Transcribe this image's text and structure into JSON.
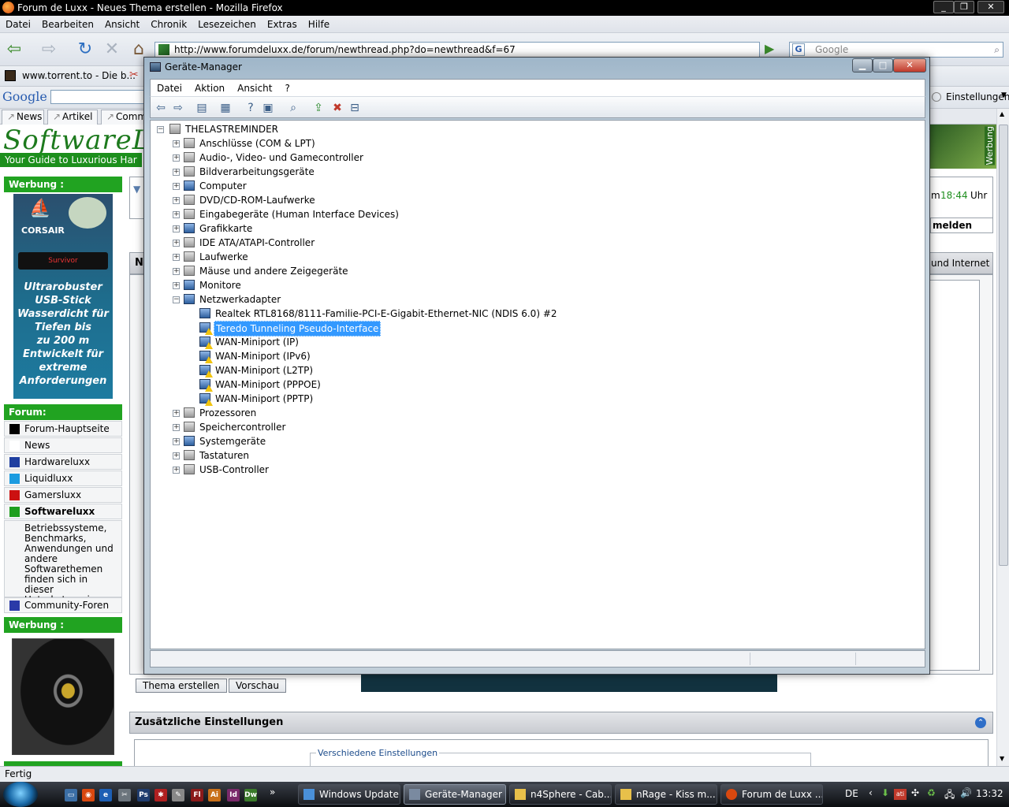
{
  "firefox": {
    "title": "Forum de Luxx - Neues Thema erstellen - Mozilla Firefox",
    "menu": [
      "Datei",
      "Bearbeiten",
      "Ansicht",
      "Chronik",
      "Lesezeichen",
      "Extras",
      "Hilfe"
    ],
    "url": "http://www.forumdeluxx.de/forum/newthread.php?do=newthread&f=67",
    "search_placeholder": "Google",
    "bookmark_1": "www.torrent.to - Die b...",
    "google_label": "Google",
    "settings_label": "Einstellungen",
    "tabs": [
      "News",
      "Artikel",
      "Comm"
    ],
    "status": "Fertig"
  },
  "webpage": {
    "logo": "SoftwareL",
    "tagline": "Your Guide to Luxurious Har",
    "werbung_1": "Werbung :",
    "ad_brand": "CORSAIR",
    "ad_stick": "Survivor",
    "ad_claim_lines": [
      "Ultrarobuster",
      "USB-Stick",
      "Wasserdicht für",
      "Tiefen bis",
      "zu 200 m",
      "Entwickelt für",
      "extreme",
      "Anforderungen"
    ],
    "forum_header": "Forum:",
    "forum_items": [
      {
        "label": "Forum-Hauptseite",
        "color": "#000000"
      },
      {
        "label": "News",
        "color": "#ffffff"
      },
      {
        "label": "Hardwareluxx",
        "color": "#1f3fa0"
      },
      {
        "label": "Liquidluxx",
        "color": "#1a9be0"
      },
      {
        "label": "Gamersluxx",
        "color": "#cc1111"
      },
      {
        "label": "Softwareluxx",
        "color": "#1e9e1e"
      }
    ],
    "forum_desc": "Betriebssysteme, Benchmarks, Anwendungen und andere Softwarethemen finden sich in dieser Unterkategorie.",
    "community": {
      "label": "Community-Foren",
      "color": "#2a3aa8"
    },
    "werbung_2": "Werbung :",
    "time_prefix": "m",
    "time_value": "18:44",
    "time_suffix": "Uhr",
    "melden": "melden",
    "internet": "und Internet",
    "ad_side": "Werbung",
    "btn_create": "Thema erstellen",
    "btn_preview": "Vorschau",
    "extra_settings_title": "Zusätzliche Einstellungen",
    "misc_settings": "Verschiedene Einstellungen"
  },
  "devmgr": {
    "title": "Geräte-Manager",
    "menu": [
      "Datei",
      "Aktion",
      "Ansicht",
      "?"
    ],
    "root": "THELASTREMINDER",
    "categories_top": [
      {
        "label": "Anschlüsse (COM & LPT)",
        "icon": "port-icon"
      },
      {
        "label": "Audio-, Video- und Gamecontroller",
        "icon": "speaker-icon"
      },
      {
        "label": "Bildverarbeitungsgeräte",
        "icon": "camera-icon"
      },
      {
        "label": "Computer",
        "icon": "computer-icon"
      },
      {
        "label": "DVD/CD-ROM-Laufwerke",
        "icon": "dvd-drive-icon"
      },
      {
        "label": "Eingabegeräte (Human Interface Devices)",
        "icon": "hid-icon"
      },
      {
        "label": "Grafikkarte",
        "icon": "display-adapter-icon"
      },
      {
        "label": "IDE ATA/ATAPI-Controller",
        "icon": "ide-controller-icon"
      },
      {
        "label": "Laufwerke",
        "icon": "disk-drive-icon"
      },
      {
        "label": "Mäuse und andere Zeigegeräte",
        "icon": "mouse-icon"
      },
      {
        "label": "Monitore",
        "icon": "monitor-icon"
      }
    ],
    "network_label": "Netzwerkadapter",
    "network_children": [
      {
        "label": "Realtek RTL8168/8111-Familie-PCI-E-Gigabit-Ethernet-NIC (NDIS 6.0) #2",
        "warning": false
      },
      {
        "label": "Teredo Tunneling Pseudo-Interface",
        "warning": true,
        "selected": true
      },
      {
        "label": "WAN-Miniport (IP)",
        "warning": true
      },
      {
        "label": "WAN-Miniport (IPv6)",
        "warning": true
      },
      {
        "label": "WAN-Miniport (L2TP)",
        "warning": true
      },
      {
        "label": "WAN-Miniport (PPPOE)",
        "warning": true
      },
      {
        "label": "WAN-Miniport (PPTP)",
        "warning": true
      }
    ],
    "categories_bottom": [
      {
        "label": "Prozessoren",
        "icon": "processor-icon"
      },
      {
        "label": "Speichercontroller",
        "icon": "storage-controller-icon"
      },
      {
        "label": "Systemgeräte",
        "icon": "system-devices-icon"
      },
      {
        "label": "Tastaturen",
        "icon": "keyboard-icon"
      },
      {
        "label": "USB-Controller",
        "icon": "usb-icon"
      }
    ]
  },
  "taskbar": {
    "tasks": [
      "Windows Update",
      "Geräte-Manager",
      "n4Sphere - Cab...",
      "nRage - Kiss m...",
      "Forum de Luxx ..."
    ],
    "language": "DE",
    "clock": "13:32"
  }
}
